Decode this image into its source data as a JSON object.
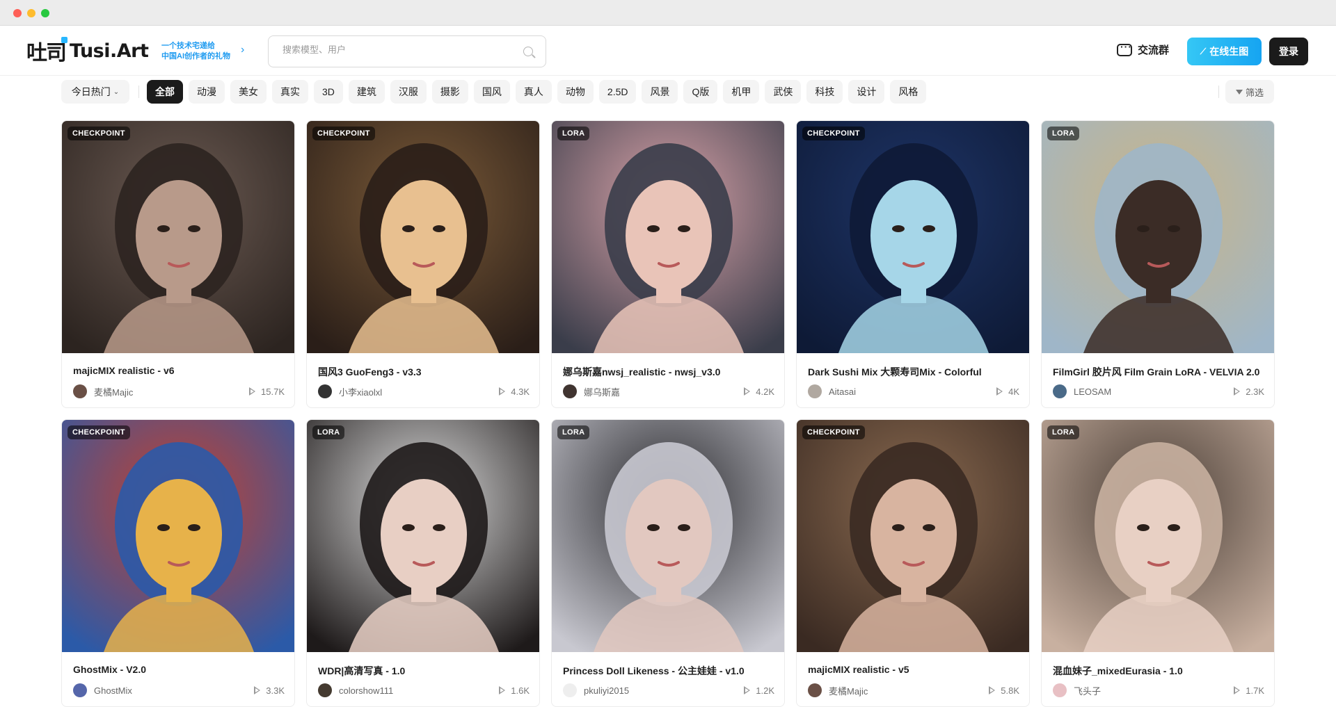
{
  "header": {
    "logo_mark": "吐司",
    "logo_text": "Tusi.Art",
    "slogan_line1": "一个技术宅递给",
    "slogan_line2": "中国AI创作者的礼物",
    "search_placeholder": "搜索模型、用户",
    "community_label": "交流群",
    "generate_label": "在线生图",
    "login_label": "登录"
  },
  "filters": {
    "sort_label": "今日热门",
    "tags": [
      "全部",
      "动漫",
      "美女",
      "真实",
      "3D",
      "建筑",
      "汉服",
      "摄影",
      "国风",
      "真人",
      "动物",
      "2.5D",
      "风景",
      "Q版",
      "机甲",
      "武侠",
      "科技",
      "设计",
      "风格"
    ],
    "active_tag": "全部",
    "filter_label": "筛选"
  },
  "cards": [
    {
      "type": "CHECKPOINT",
      "title": "majicMIX realistic - v6",
      "author": "麦橘Majic",
      "runs": "15.7K",
      "colors": [
        "#6b5a52",
        "#2c2420",
        "#b89a8a"
      ],
      "avatar": "#6a5046"
    },
    {
      "type": "CHECKPOINT",
      "title": "国风3 GuoFeng3 - v3.3",
      "author": "小李xiaolxl",
      "runs": "4.3K",
      "colors": [
        "#7a5a38",
        "#2a1e18",
        "#e8c090"
      ],
      "avatar": "#333333"
    },
    {
      "type": "LORA",
      "title": "娜乌斯嘉nwsj_realistic - nwsj_v3.0",
      "author": "娜乌斯嘉",
      "runs": "4.2K",
      "colors": [
        "#d8a2a8",
        "#3a3d4a",
        "#e9c4b8"
      ],
      "avatar": "#403430"
    },
    {
      "type": "CHECKPOINT",
      "title": "Dark Sushi Mix 大颗寿司Mix - Colorful",
      "author": "Aitasai",
      "runs": "4K",
      "colors": [
        "#1e3466",
        "#0e1a36",
        "#a6d6e8"
      ],
      "avatar": "#b0a8a0"
    },
    {
      "type": "LORA",
      "title": "FilmGirl 胶片风 Film Grain LoRA - VELVIA 2.0",
      "author": "LEOSAM",
      "runs": "2.3K",
      "colors": [
        "#c9b487",
        "#9fb6c8",
        "#3b2c26"
      ],
      "avatar": "#4a6a88"
    },
    {
      "type": "CHECKPOINT",
      "title": "GhostMix - V2.0",
      "author": "GhostMix",
      "runs": "3.3K",
      "colors": [
        "#c4402e",
        "#2b5aa8",
        "#e7b24a"
      ],
      "avatar": "#5566aa"
    },
    {
      "type": "LORA",
      "title": "WDR|高清写真 - 1.0",
      "author": "colorshow111",
      "runs": "1.6K",
      "colors": [
        "#dcdcdc",
        "#1e1a1a",
        "#e8cfc4"
      ],
      "avatar": "#443a30"
    },
    {
      "type": "LORA",
      "title": "Princess Doll Likeness - 公主娃娃 - v1.0",
      "author": "pkuliyi2015",
      "runs": "1.2K",
      "colors": [
        "#2a2a2e",
        "#c8c8d0",
        "#e2c8c0"
      ],
      "avatar": "#eeeeee"
    },
    {
      "type": "CHECKPOINT",
      "title": "majicMIX realistic - v5",
      "author": "麦橘Majic",
      "runs": "5.8K",
      "colors": [
        "#8a6a50",
        "#3a2a22",
        "#d8b4a0"
      ],
      "avatar": "#6a5046"
    },
    {
      "type": "LORA",
      "title": "混血妹子_mixedEurasia - 1.0",
      "author": "飞头子",
      "runs": "1.7K",
      "colors": [
        "#4a3e36",
        "#c8b0a0",
        "#e8d0c4"
      ],
      "avatar": "#e8c0c4"
    }
  ]
}
